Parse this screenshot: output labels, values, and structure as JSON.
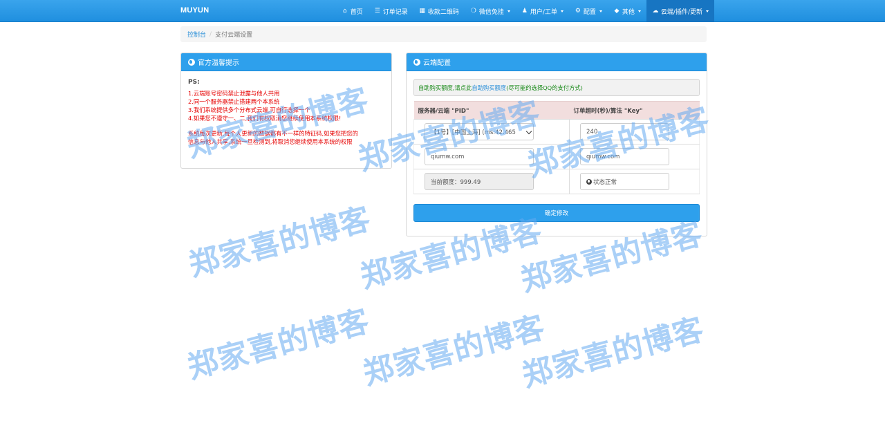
{
  "navbar": {
    "brand": "MUYUN",
    "items": [
      {
        "icon": "home-icon",
        "glyph": "⌂",
        "label": "首页"
      },
      {
        "icon": "list-icon",
        "glyph": "☰",
        "label": "订单记录"
      },
      {
        "icon": "qrcode-icon",
        "glyph": "▦",
        "label": "收款二维码"
      },
      {
        "icon": "wechat-icon",
        "glyph": "❍",
        "label": "微信免挂"
      },
      {
        "icon": "user-icon",
        "glyph": "♟",
        "label": "用户/工单"
      },
      {
        "icon": "gear-icon",
        "glyph": "⚙",
        "label": "配置"
      },
      {
        "icon": "cube-icon",
        "glyph": "◆",
        "label": "其他"
      },
      {
        "icon": "cloud-icon",
        "glyph": "☁",
        "label": "云端/插件/更新"
      }
    ]
  },
  "breadcrumb": {
    "home": "控制台",
    "separator": "/",
    "current": "支付云端设置"
  },
  "left_panel": {
    "title": "官方温馨提示",
    "ps": "PS:",
    "lines": [
      "1.云端账号密码禁止泄露与他人共用",
      "2.同一个服务器禁止搭建两个本系统",
      "3.我们系统提供多个分布式云端,可自行选择一个",
      "4.如果您不遵守一、二,我们有权取消您继续使用本系统权限!"
    ],
    "note_lines": [
      "系统每次更新,每个人更新的数据都有不一样的特征码,如果您把您的",
      "信息与他人共享,系统一旦检测到,将取消您继续使用本系统的权限"
    ]
  },
  "right_panel": {
    "title": "云端配置",
    "alert_prefix": "自助购买额度,请点此",
    "alert_link": "自助购买额度",
    "alert_suffix": "(尽可能的选择QQ的支付方式)",
    "col1_header": "服务器/云端 \"PID\"",
    "col2_header": "订单超时(秒)/算法 \"Key\"",
    "server_select": "【1号】[中国上海] (ms:42.465",
    "timeout_value": "240",
    "pid_value": "qiumw.com",
    "key_value": "qiumw.com",
    "quota_text": "当前额度：999.49",
    "status_text": "状态正常",
    "submit_label": "确定修改"
  },
  "watermark": "郑家喜的博客"
}
